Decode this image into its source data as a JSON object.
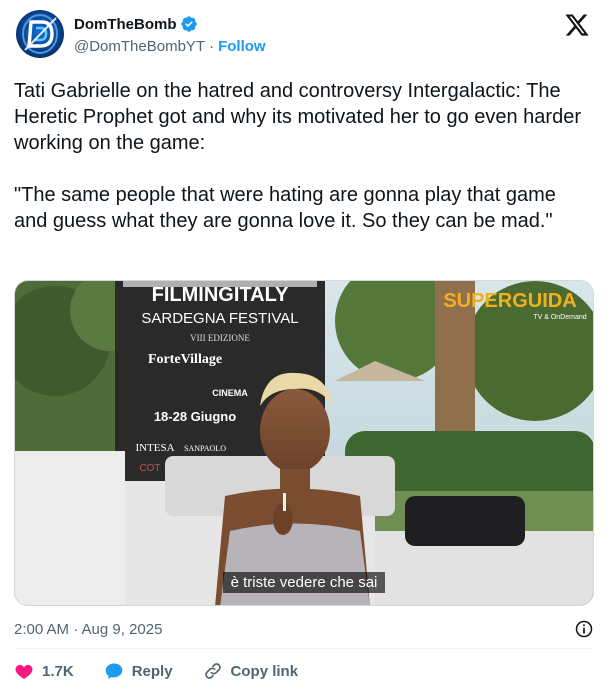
{
  "author": {
    "display_name": "DomTheBomb",
    "handle": "@DomTheBombYT",
    "separator": "·",
    "follow_label": "Follow",
    "verified_color": "#1d9bf0",
    "avatar_icon": "neon-d-logo-icon"
  },
  "tweet": {
    "text": "Tati Gabrielle on the hatred and controversy Intergalactic: The Heretic Prophet got and why its motivated her to go even harder working on the game:\n\n\"The same people that were hating are gonna play that game and guess what they are gonna love it. So they can be mad.\""
  },
  "media": {
    "type": "video-thumbnail",
    "banner_lines": [
      "FILMINGITALY",
      "SARDEGNA FESTIVAL",
      "VIII EDIZIONE",
      "ForteVillage",
      "CINEMA",
      "18-28 Giugno",
      "INTESA",
      "SANPAOLO",
      "COT"
    ],
    "watermark": "SUPERGUIDA",
    "watermark_sub": "TV & OnDemand",
    "subtitle": "è triste vedere che sai"
  },
  "timestamp": "2:00 AM · Aug 9, 2025",
  "actions": {
    "like_count": "1.7K",
    "reply_label": "Reply",
    "copy_link_label": "Copy link"
  },
  "colors": {
    "accent": "#1d9bf0",
    "like": "#f91880",
    "secondary_text": "#536471"
  }
}
